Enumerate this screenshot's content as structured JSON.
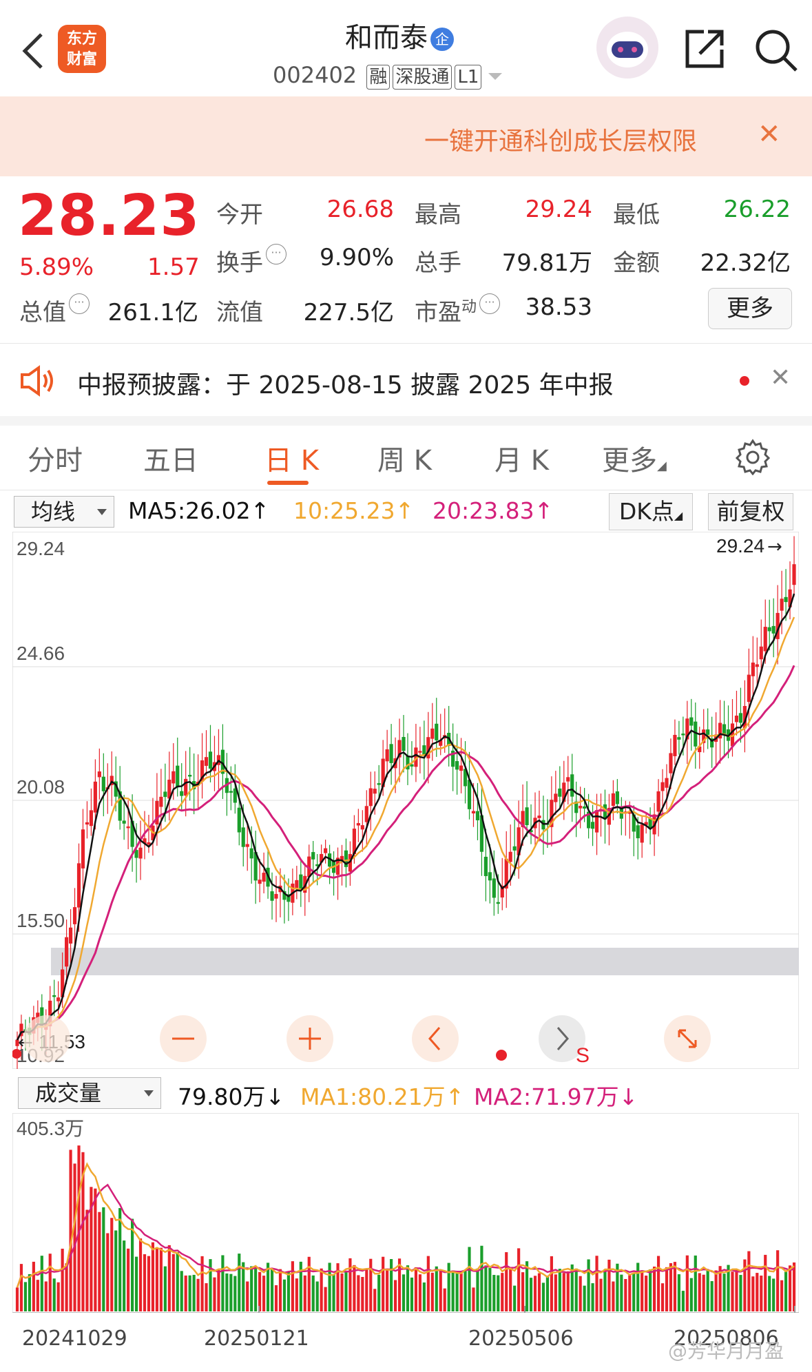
{
  "header": {
    "logo_text_1": "东方",
    "logo_text_2": "财富",
    "stock_name": "和而泰",
    "badge_qi": "企",
    "stock_code": "002402",
    "tags": [
      "融",
      "深股通",
      "L1"
    ]
  },
  "banner": {
    "text": "一键开通科创成长层权限"
  },
  "quote": {
    "price": "28.23",
    "change_pct": "5.89%",
    "change": "1.57",
    "fields": [
      {
        "label": "今开",
        "value": "26.68",
        "color": "red"
      },
      {
        "label": "最高",
        "value": "29.24",
        "color": "red"
      },
      {
        "label": "最低",
        "value": "26.22",
        "color": "green"
      },
      {
        "label": "换手",
        "value": "9.90%",
        "color": "black"
      },
      {
        "label": "总手",
        "value": "79.81万",
        "color": "black"
      },
      {
        "label": "金额",
        "value": "22.32亿",
        "color": "black"
      },
      {
        "label": "总值",
        "value": "261.1亿",
        "color": "black"
      },
      {
        "label": "流值",
        "value": "227.5亿",
        "color": "black"
      },
      {
        "label": "市盈",
        "label_sup": "动",
        "value": "38.53",
        "color": "black"
      }
    ],
    "more_label": "更多"
  },
  "notice": {
    "text": "中报预披露：于 2025-08-15 披露 2025 年中报"
  },
  "tabs": [
    "分时",
    "五日",
    "日 K",
    "周 K",
    "月 K",
    "更多"
  ],
  "active_tab": "日 K",
  "ma_bar": {
    "select": "均线",
    "ma5": "MA5:26.02",
    "ma10": "10:25.23",
    "ma20": "20:23.83",
    "dk_label": "DK点",
    "fq_label": "前复权",
    "colors": {
      "ma5": "#111111",
      "ma10": "#f0a830",
      "ma20": "#d4207a"
    }
  },
  "kline_labels": {
    "y_ticks": [
      "29.24",
      "24.66",
      "20.08",
      "15.50",
      "10.92"
    ],
    "max_marker": "29.24",
    "min_marker": "11.53",
    "s_marker": "S"
  },
  "volume_bar": {
    "select": "成交量",
    "vol": "79.80万",
    "ma1": "MA1:80.21万",
    "ma2": "MA2:71.97万",
    "max_label": "405.3万"
  },
  "x_axis": [
    "20241029",
    "20250121",
    "20250506",
    "20250806"
  ],
  "watermark": "@芳华月月盈",
  "chart_data": {
    "type": "candlestick",
    "title": "",
    "y_range": [
      10.92,
      29.24
    ],
    "y_ticks": [
      29.24,
      24.66,
      20.08,
      15.5,
      10.92
    ],
    "x_ticks": [
      "20241029",
      "20250121",
      "20250506",
      "20250806"
    ],
    "ma_last": {
      "MA5": 26.02,
      "MA10": 25.23,
      "MA20": 23.83
    },
    "close_path": [
      11.5,
      11.8,
      12.3,
      13.5,
      15.5,
      19.0,
      21.0,
      20.5,
      18.5,
      18.0,
      19.5,
      20.5,
      20.2,
      20.8,
      21.6,
      20.8,
      19.5,
      18.2,
      17.0,
      16.3,
      16.8,
      17.5,
      17.8,
      17.6,
      18.0,
      19.0,
      19.8,
      21.5,
      22.0,
      21.0,
      21.8,
      22.6,
      21.5,
      20.0,
      18.5,
      16.5,
      17.6,
      19.0,
      19.3,
      19.5,
      20.4,
      19.8,
      19.4,
      19.5,
      19.6,
      19.3,
      19.0,
      19.6,
      21.5,
      23.0,
      22.0,
      21.9,
      22.4,
      23.0,
      24.5,
      25.6,
      26.8,
      28.23
    ],
    "volume": {
      "max": 405.3,
      "last": 79.8,
      "ma1": 80.21,
      "ma2": 71.97,
      "unit": "万"
    }
  }
}
